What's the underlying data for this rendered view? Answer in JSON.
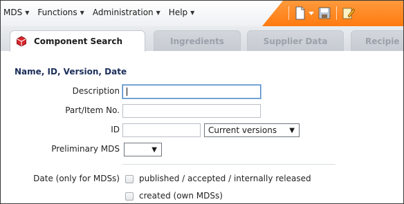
{
  "menu": {
    "items": [
      {
        "label": "MDS"
      },
      {
        "label": "Functions"
      },
      {
        "label": "Administration"
      },
      {
        "label": "Help"
      }
    ]
  },
  "toolbar": {
    "icons": [
      "new-document-icon",
      "dropdown-caret-icon",
      "save-icon",
      "edit-icon"
    ]
  },
  "tabs": [
    {
      "label": "Component Search",
      "active": true,
      "icon": "cube-icon"
    },
    {
      "label": "Ingredients",
      "active": false
    },
    {
      "label": "Supplier Data",
      "active": false
    },
    {
      "label": "Recipie",
      "active": false
    }
  ],
  "form": {
    "section_title": "Name, ID, Version, Date",
    "description_label": "Description",
    "description_value": "",
    "part_label": "Part/Item No.",
    "part_value": "",
    "id_label": "ID",
    "id_value": "",
    "version_select": "Current versions",
    "preliminary_label": "Preliminary MDS",
    "preliminary_select": "",
    "date_label": "Date (only for MDSs)",
    "date_options": [
      {
        "label": "published / accepted / internally released",
        "checked": false
      },
      {
        "label": "created (own MDSs)",
        "checked": false
      }
    ]
  },
  "colors": {
    "accent_orange": "#ff7a10",
    "title_blue": "#1a2d5a",
    "focus_blue": "#4f86c6",
    "cube_red": "#d8262c"
  }
}
